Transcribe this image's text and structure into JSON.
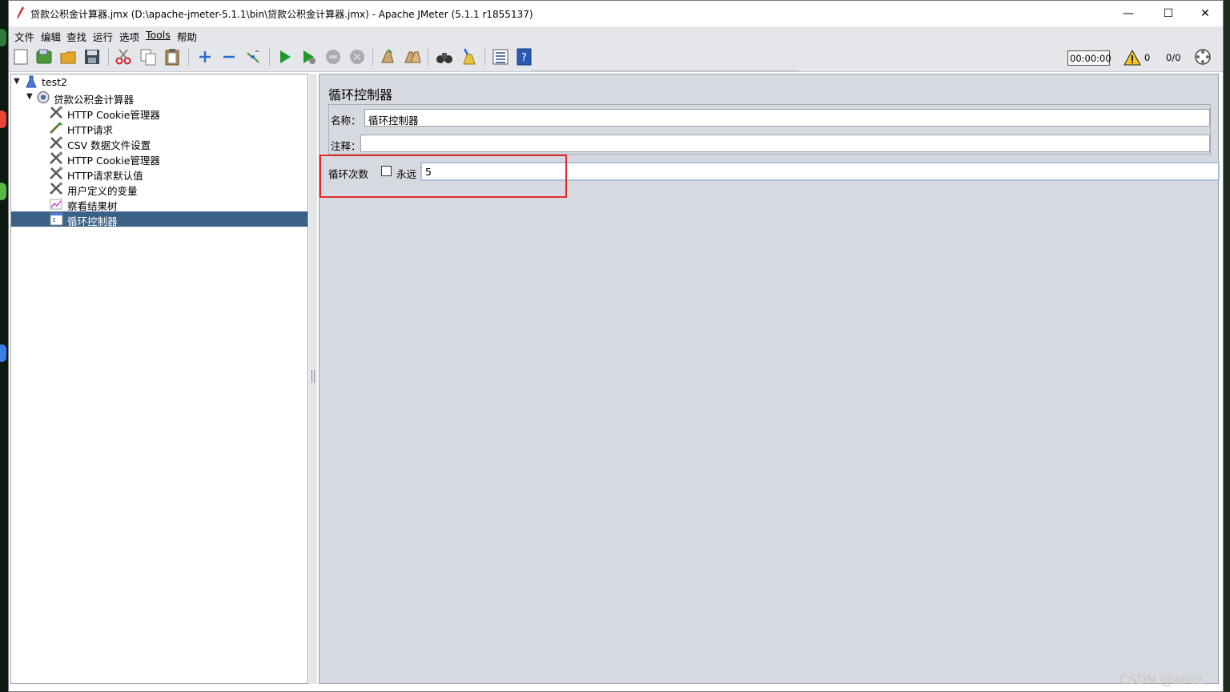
{
  "window": {
    "title": "贷款公积金计算器.jmx (D:\\apache-jmeter-5.1.1\\bin\\贷款公积金计算器.jmx) - Apache JMeter (5.1.1 r1855137)",
    "controls": {
      "minimize": "—",
      "maximize": "☐",
      "close": "✕"
    }
  },
  "menu": [
    "文件",
    "编辑",
    "查找",
    "运行",
    "选项",
    "Tools",
    "帮助"
  ],
  "toolbar": {
    "icons": [
      "new-icon",
      "templates-icon",
      "open-icon",
      "save-icon",
      "cut-icon",
      "copy-icon",
      "paste-icon",
      "expand-icon",
      "collapse-icon",
      "toggle-icon",
      "start-icon",
      "start-no-pause-icon",
      "stop-icon",
      "shutdown-icon",
      "clear-icon",
      "clear-all-icon",
      "search-icon",
      "reset-search-icon",
      "function-helper-icon",
      "help-icon"
    ],
    "timer": "00:00:00",
    "warning_count": "0",
    "thread_count": "0/0"
  },
  "tree": {
    "items": [
      {
        "label": "test2",
        "level": 0,
        "icon": "test-plan-icon"
      },
      {
        "label": "贷款公积金计算器",
        "level": 1,
        "icon": "thread-group-icon"
      },
      {
        "label": "HTTP Cookie管理器",
        "level": 2,
        "icon": "config-element-icon"
      },
      {
        "label": "HTTP请求",
        "level": 2,
        "icon": "sampler-icon"
      },
      {
        "label": "CSV 数据文件设置",
        "level": 2,
        "icon": "config-element-icon"
      },
      {
        "label": "HTTP Cookie管理器",
        "level": 2,
        "icon": "config-element-icon"
      },
      {
        "label": "HTTP请求默认值",
        "level": 2,
        "icon": "config-element-icon"
      },
      {
        "label": "用户定义的变量",
        "level": 2,
        "icon": "config-element-icon"
      },
      {
        "label": "察看结果树",
        "level": 2,
        "icon": "listener-icon"
      },
      {
        "label": "循环控制器",
        "level": 2,
        "icon": "logic-controller-icon",
        "selected": true
      }
    ]
  },
  "panel": {
    "title": "循环控制器",
    "name_label": "名称：",
    "name_value": "循环控制器",
    "comment_label": "注释：",
    "comment_value": "",
    "loop_label": "循环次数",
    "forever_label": "永远",
    "loop_value": "5"
  },
  "watermark": "CSDN @aliez.."
}
